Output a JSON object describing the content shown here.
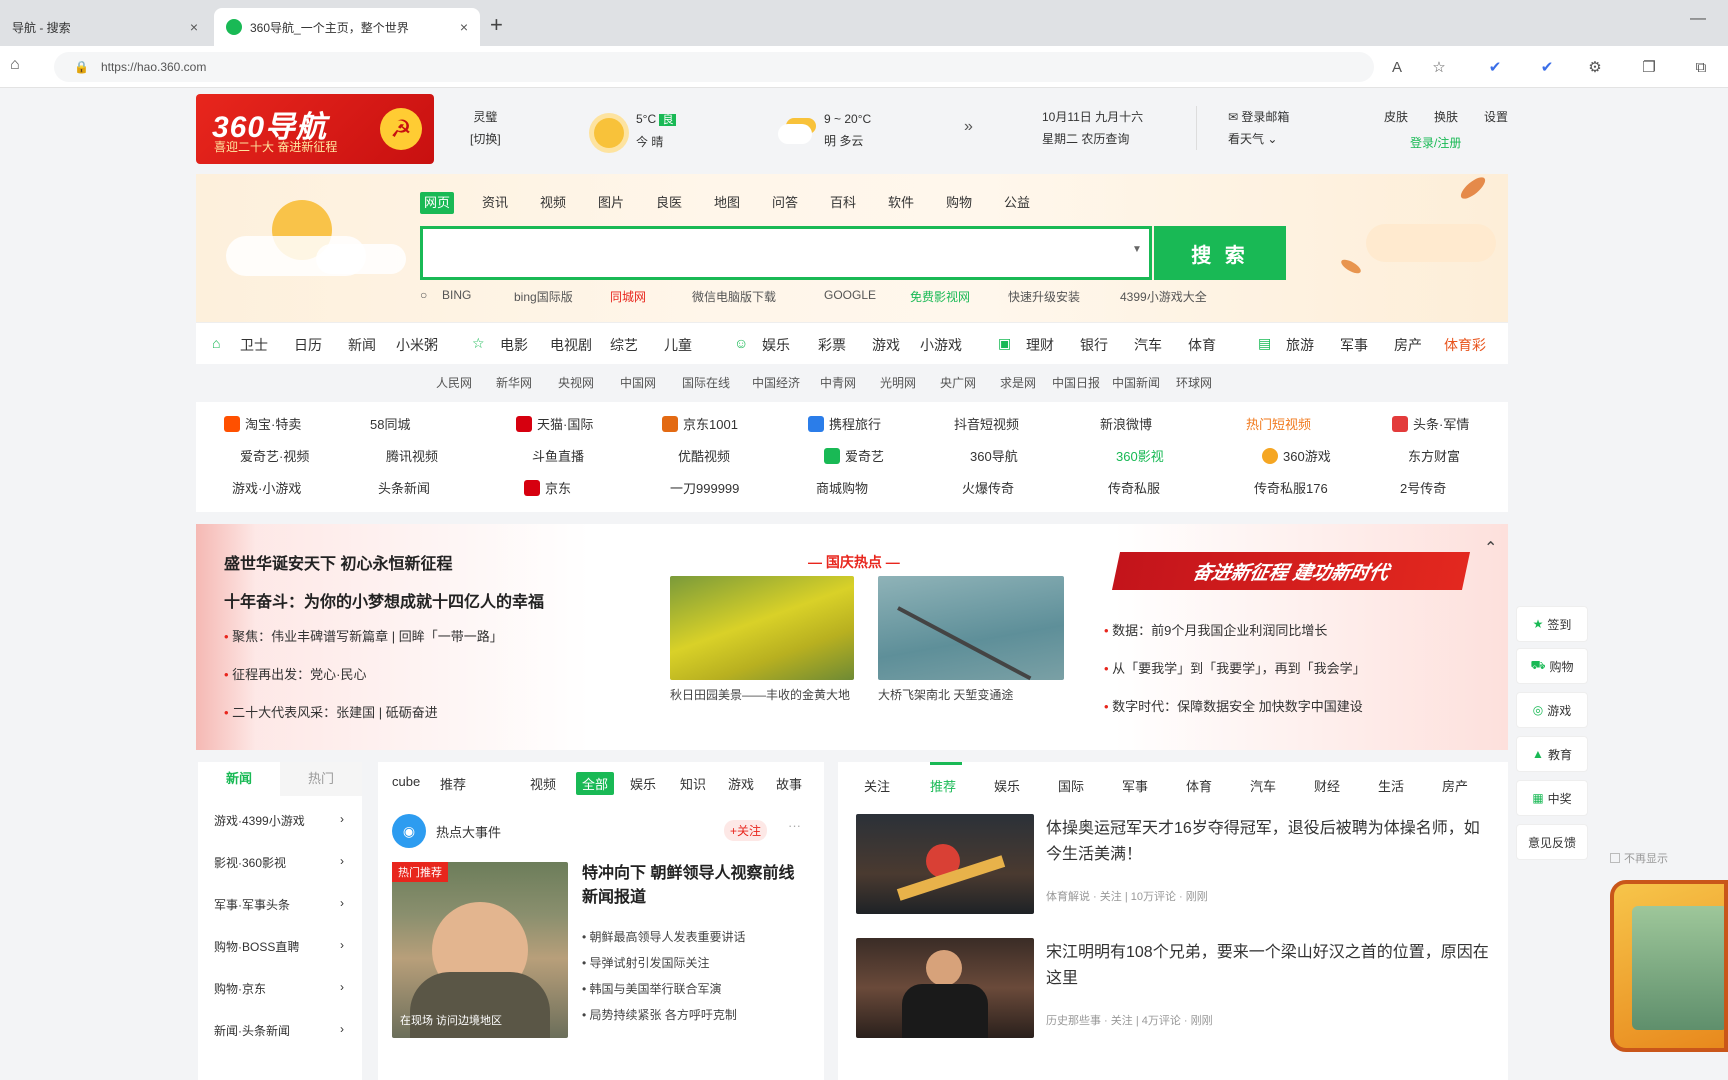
{
  "browser": {
    "tabs": [
      {
        "title": "导航 - 搜索",
        "close": "×"
      },
      {
        "title": "360导航_一个主页，整个世界",
        "close": "×"
      }
    ],
    "new_tab": "+",
    "url": "https://hao.360.com",
    "toolbar_icons": [
      "read-aloud-icon",
      "favorite-icon",
      "extension-icon",
      "extension-icon",
      "settings-icon",
      "collections-icon",
      "share-icon"
    ]
  },
  "header": {
    "logo_title": "360导航",
    "logo_slogan": "喜迎二十大 奋进新征程",
    "city": "灵璧",
    "city_switch": "[切换]",
    "weather_now_temp": "5°C",
    "weather_now_aqi": "良",
    "weather_now_cond": "今 晴",
    "weather_fore_temp": "9 ~ 20°C",
    "weather_fore_cond": "明 多云",
    "date": "10月11日 九月十六",
    "weekday": "星期二 农历查询",
    "mail": "登录邮箱",
    "toggle": "看天气",
    "links": [
      "皮肤",
      "换肤",
      "设置"
    ],
    "login": "登录/注册"
  },
  "search": {
    "tabs": [
      "网页",
      "资讯",
      "视频",
      "图片",
      "良医",
      "地图",
      "问答",
      "百科",
      "软件",
      "购物",
      "公益"
    ],
    "active_tab": "网页",
    "button": "搜 索",
    "placeholder": "",
    "suggestions": [
      "BING",
      "bing国际版",
      "同城网",
      "微信电脑版下载",
      "GOOGLE",
      "免费影视网",
      "快速升级安装",
      "4399小游戏大全"
    ]
  },
  "categories": {
    "groups": [
      {
        "icon": "home-icon",
        "items": [
          "卫士",
          "日历",
          "新闻",
          "小米粥"
        ]
      },
      {
        "icon": "star-icon",
        "items": [
          "电影",
          "电视剧",
          "综艺",
          "儿童"
        ]
      },
      {
        "icon": "game-icon",
        "items": [
          "娱乐",
          "彩票",
          "游戏",
          "小游戏"
        ]
      },
      {
        "icon": "mall-icon",
        "items": [
          "理财",
          "银行",
          "汽车",
          "体育"
        ]
      },
      {
        "icon": "travel-icon",
        "items": [
          "旅游",
          "军事",
          "房产",
          "体育彩"
        ]
      }
    ],
    "sub": [
      "人民网",
      "新华网",
      "央视网",
      "中国网",
      "国际在线",
      "中国经济",
      "中青网",
      "光明网",
      "央广网",
      "求是网",
      "中国日报",
      "中国新闻",
      "环球网"
    ]
  },
  "sites": {
    "rows": [
      [
        "淘宝·特卖",
        "58同城",
        "天猫·国际",
        "京东1001",
        "携程旅行",
        "抖音短视频",
        "新浪微博",
        "热门短视频",
        "头条·军情"
      ],
      [
        "爱奇艺·视频",
        "腾讯视频",
        "斗鱼直播",
        "优酷视频",
        "爱奇艺",
        "360导航",
        "360影视",
        "360游戏",
        "东方财富"
      ],
      [
        "游戏·小游戏",
        "头条新闻",
        "京东",
        "一刀999999",
        "商城购物",
        "火爆传奇",
        "传奇私服",
        "传奇私服176",
        "2号传奇"
      ]
    ]
  },
  "banner": {
    "headlines": [
      "盛世华诞安天下 初心永恒新征程",
      "十年奋斗：为你的小梦想成就十四亿人的幸福"
    ],
    "list": [
      "聚焦：伟业丰碑谱写新篇章 | 回眸「一带一路」",
      "征程再出发：党心·民心",
      "二十大代表风采：张建国 | 砥砺奋进"
    ],
    "center_title": "— 国庆热点 —",
    "photo1_caption": "秋日田园美景——丰收的金黄大地",
    "photo2_caption": "大桥飞架南北 天堑变通途",
    "ribbon": "奋进新征程 建功新时代",
    "right_list": [
      "数据：前9个月我国企业利润同比增长",
      "从「要我学」到「我要学」，再到「我会学」",
      "数字时代：保障数据安全 加快数字中国建设"
    ]
  },
  "left_panel": {
    "tabs": [
      "新闻",
      "热门"
    ],
    "items": [
      "游戏·4399小游戏",
      "影视·360影视",
      "军事·军事头条",
      "购物·BOSS直聘",
      "购物·京东",
      "新闻·头条新闻"
    ]
  },
  "mid_panel": {
    "tabs": [
      "cube",
      "推荐",
      "视频",
      "全部",
      "娱乐",
      "知识",
      "游戏",
      "故事"
    ],
    "active_tab": "全部",
    "source": "热点大事件",
    "follow": "+关注",
    "more": "···",
    "image_tag": "热门推荐",
    "image_caption": "在现场 访问边境地区",
    "title": "特冲向下 朝鲜领导人视察前线 新闻报道",
    "bullets": [
      "朝鲜最高领导人发表重要讲话",
      "导弹试射引发国际关注",
      "韩国与美国举行联合军演",
      "局势持续紧张 各方呼吁克制"
    ]
  },
  "news_panel": {
    "tabs": [
      "关注",
      "推荐",
      "娱乐",
      "国际",
      "军事",
      "体育",
      "汽车",
      "财经",
      "生活",
      "房产"
    ],
    "active_tab": "推荐",
    "items": [
      {
        "title": "体操奥运冠军天才16岁夺得冠军，退役后被聘为体操名师，如今生活美满！",
        "meta": "体育解说 · 关注 | 10万评论 · 刚刚"
      },
      {
        "title": "宋江明明有108个兄弟，要来一个梁山好汉之首的位置，原因在这里",
        "meta": "历史那些事 · 关注 | 4万评论 · 刚刚"
      }
    ]
  },
  "right_float": [
    "签到",
    "购物",
    "游戏",
    "教育",
    "中奖",
    "意见反馈"
  ],
  "corner": "不再显示"
}
